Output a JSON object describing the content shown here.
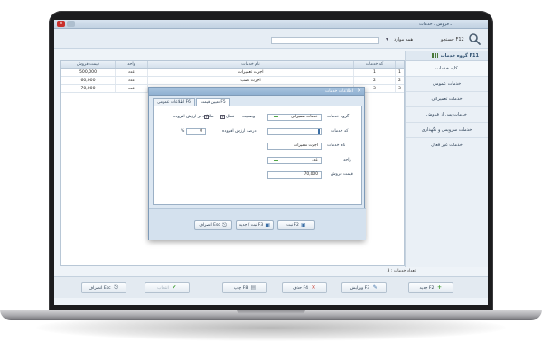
{
  "app": {
    "title": "ـ فروش ـ خدمات",
    "close_glyph": "×"
  },
  "search": {
    "label": "جستجو F12",
    "mode_value": "همه موارد",
    "placeholder": ""
  },
  "sidebar": {
    "header": "گروه خدمات F11",
    "items": [
      {
        "label": "کلیه خدمات",
        "active": true
      },
      {
        "label": "خدمات عمومی",
        "active": false
      },
      {
        "label": "خدمات تعمیراتی",
        "active": false
      },
      {
        "label": "خدمات پس از فروش",
        "active": false
      },
      {
        "label": "خدمات سرویس و نگهداری",
        "active": false
      },
      {
        "label": "خدمات غیر فعال",
        "active": false
      }
    ]
  },
  "table": {
    "headers": {
      "price": "قیمت فروش",
      "unit": "واحد",
      "name": "نام خدمات",
      "code": "کد خدمات"
    },
    "rows": [
      {
        "idx": "1",
        "code": "1",
        "name": "اجرت تعمیرات",
        "unit": "عدد",
        "price": "500,000"
      },
      {
        "idx": "2",
        "code": "2",
        "name": "اجرت نصب",
        "unit": "عدد",
        "price": "60,000"
      },
      {
        "idx": "3",
        "code": "3",
        "name": "",
        "unit": "عدد",
        "price": "70,000"
      }
    ],
    "count_label": "تعداد خدمات : 3"
  },
  "toolbar": {
    "new": "جدید F2",
    "edit": "ویرایش F3",
    "delete": "حذف F4",
    "print": "چاپ F8",
    "select": "انتخاب",
    "cancel": "انصراف Esc"
  },
  "modal": {
    "title": "اطلاعات خدمات",
    "close_glyph": "×",
    "tabs": {
      "general": "اطلاعات عمومی F6",
      "price": "تعیین قیمت F5"
    },
    "fields": {
      "group_label": "گروه خدمات",
      "group_value": "خدمات تعمیراتی",
      "code_label": "کد خدمات",
      "code_value": "",
      "name_label": "نام خدمات",
      "name_value": "اجرت تعمیرات",
      "unit_label": "واحد",
      "unit_value": "عدد",
      "price_label": "قیمت فروش",
      "price_value": "70,000",
      "status_label": "وضعیت",
      "active_label": "فعال",
      "active_checked": true,
      "tax_label": "مالیات بر ارزش افزوده",
      "tax_checked": true,
      "tax_rate_label": "درصد ارزش افزوده",
      "tax_rate_value": "0",
      "percent_sign": "%"
    },
    "buttons": {
      "save": "ثبت F2",
      "save_new": "ثبت / جدید F3",
      "cancel": "انصراف Esc"
    }
  },
  "colors": {
    "accent": "#8fb0d1",
    "add": "#3c9b2e",
    "delete": "#c83a2e"
  }
}
